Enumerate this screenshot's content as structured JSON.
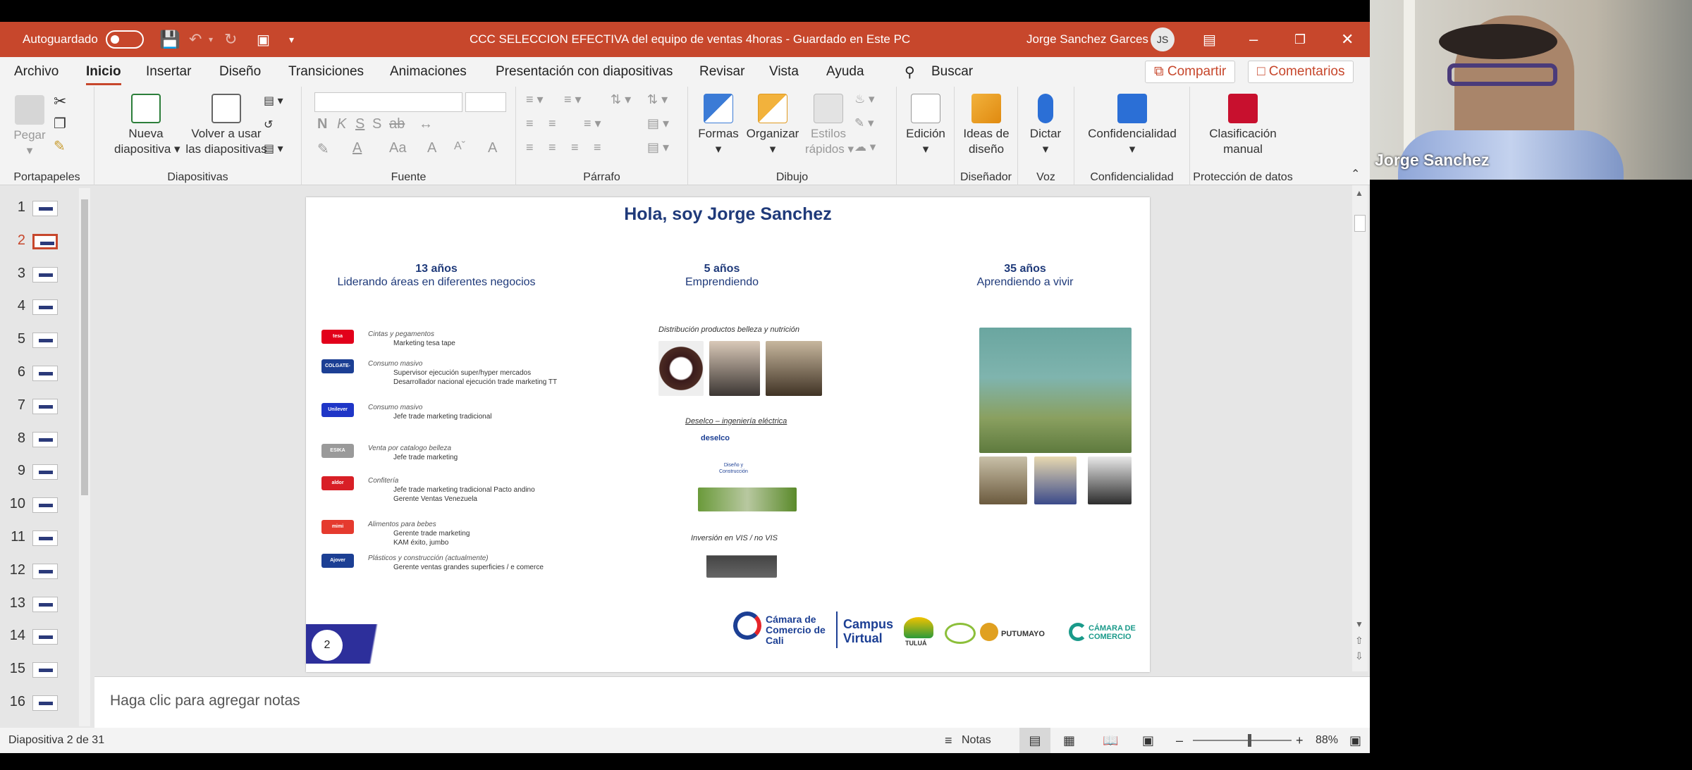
{
  "app": {
    "autosave_label": "Autoguardado",
    "title": "CCC SELECCION EFECTIVA del equipo de ventas 4horas  -  Guardado en Este PC",
    "user_name": "Jorge Sanchez Garces",
    "user_initials": "JS"
  },
  "menu": {
    "tabs": [
      "Archivo",
      "Inicio",
      "Insertar",
      "Diseño",
      "Transiciones",
      "Animaciones",
      "Presentación con diapositivas",
      "Revisar",
      "Vista",
      "Ayuda"
    ],
    "search": "Buscar",
    "share": "Compartir",
    "comments": "Comentarios"
  },
  "ribbon": {
    "portapapeles": {
      "paste": "Pegar",
      "label": "Portapapeles"
    },
    "diapositivas": {
      "new_slide_1": "Nueva",
      "new_slide_2": "diapositiva",
      "reuse_1": "Volver a usar",
      "reuse_2": "las diapositivas",
      "label": "Diapositivas"
    },
    "fuente": {
      "label": "Fuente",
      "bold": "N",
      "italic": "K",
      "underline": "S",
      "strike": "S",
      "abc": "ab",
      "size_up": "A",
      "size_down": "A",
      "case": "Aa",
      "clear": "A"
    },
    "parrafo": {
      "label": "Párrafo"
    },
    "dibujo": {
      "shapes": "Formas",
      "arrange": "Organizar",
      "styles_1": "Estilos",
      "styles_2": "rápidos",
      "label": "Dibujo"
    },
    "edicion": {
      "label": "Edición"
    },
    "disenador": {
      "ideas_1": "Ideas de",
      "ideas_2": "diseño",
      "label": "Diseñador"
    },
    "voz": {
      "dictate": "Dictar",
      "label": "Voz"
    },
    "confidencialidad": {
      "button": "Confidencialidad",
      "label": "Confidencialidad"
    },
    "proteccion": {
      "btn_1": "Clasificación",
      "btn_2": "manual",
      "label": "Protección de datos"
    }
  },
  "thumbnails": [
    "1",
    "2",
    "3",
    "4",
    "5",
    "6",
    "7",
    "8",
    "9",
    "10",
    "11",
    "12",
    "13",
    "14",
    "15",
    "16"
  ],
  "selected_thumbnail": 2,
  "slide": {
    "title": "Hola, soy Jorge Sanchez",
    "columns": [
      {
        "heading": "13 años",
        "sub": "Liderando áreas en diferentes negocios"
      },
      {
        "heading": "5 años",
        "sub": "Emprendiendo"
      },
      {
        "heading": "35 años",
        "sub": "Aprendiendo a vivir"
      }
    ],
    "experience": [
      {
        "logo": "tesa",
        "color": "#e2001a",
        "area": "Cintas y pegamentos",
        "roles": [
          "Marketing tesa tape"
        ]
      },
      {
        "logo": "COLGATE-PALMOLIVE",
        "color": "#1c3f94",
        "area": "Consumo masivo",
        "roles": [
          "Supervisor ejecución super/hyper mercados",
          "Desarrollador nacional ejecución trade marketing TT"
        ]
      },
      {
        "logo": "Unilever",
        "color": "#1f36c7",
        "area": "Consumo masivo",
        "roles": [
          "Jefe trade marketing tradicional"
        ]
      },
      {
        "logo": "ESIKA",
        "color": "#9a9a9a",
        "area": "Venta por catalogo belleza",
        "roles": [
          "Jefe trade marketing"
        ]
      },
      {
        "logo": "aldor",
        "color": "#d81f26",
        "area": "Confitería",
        "roles": [
          "Jefe trade marketing tradicional Pacto andino",
          "Gerente Ventas Venezuela"
        ]
      },
      {
        "logo": "mimi",
        "color": "#e53a2e",
        "area": "Alimentos para bebes",
        "roles": [
          "Gerente trade marketing",
          "KAM éxito, jumbo"
        ]
      },
      {
        "logo": "Ajover",
        "color": "#1c3f94",
        "area": "Plásticos y construcción  (actualmente)",
        "roles": [
          "Gerente ventas grandes superficies / e comerce"
        ]
      }
    ],
    "entrepreneur": {
      "line1": "Distribución productos belleza y nutrición",
      "line2": "Deselco – ingeniería eléctrica",
      "deselco_logo": "deselco",
      "deselco_doc_1": "Diseño y",
      "deselco_doc_2": "Construcción",
      "line3": "Inversión en VIS / no VIS"
    },
    "page_number": "2",
    "footer_logos": {
      "camara_1": "Cámara de",
      "camara_2": "Comercio de",
      "camara_3": "Cali",
      "campus_1": "Campus",
      "campus_2": "Virtual",
      "tulua": "TULUÁ",
      "putumayo": "PUTUMAYO",
      "camara_right_1": "CÁMARA DE",
      "camara_right_2": "COMERCIO"
    }
  },
  "notes_placeholder": "Haga clic para agregar notas",
  "status": {
    "slide_info": "Diapositiva 2 de 31",
    "notes": "Notas",
    "zoom": "88%"
  },
  "video": {
    "participant_name": "Jorge Sanchez"
  },
  "colors": {
    "accent": "#c7472c",
    "slide_title": "#1f3a7a"
  }
}
